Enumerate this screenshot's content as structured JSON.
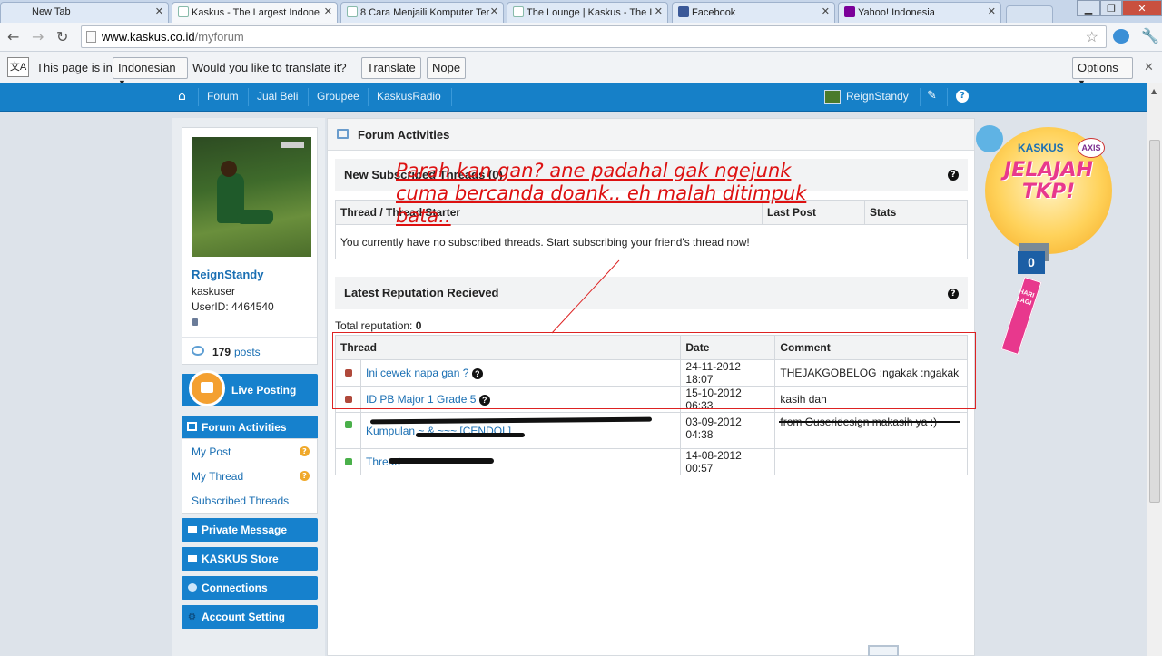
{
  "browser": {
    "tabs": [
      {
        "title": "New Tab",
        "active": false
      },
      {
        "title": "Kaskus - The Largest Indone",
        "active": true
      },
      {
        "title": "8 Cara Menjaili Komputer Ter",
        "active": false
      },
      {
        "title": "The Lounge | Kaskus - The L",
        "active": false
      },
      {
        "title": "Facebook",
        "active": false
      },
      {
        "title": "Yahoo! Indonesia",
        "active": false
      }
    ],
    "url_host": "www.kaskus.co.id",
    "url_path": "/myforum"
  },
  "translate_bar": {
    "prefix": "This page is in",
    "language": "Indonesian",
    "question": "Would you like to translate it?",
    "translate_label": "Translate",
    "nope_label": "Nope",
    "options_label": "Options"
  },
  "site_nav": {
    "items": [
      "Forum",
      "Jual Beli",
      "Groupee",
      "KaskusRadio"
    ],
    "username": "ReignStandy"
  },
  "profile": {
    "username": "ReignStandy",
    "rank": "kaskuser",
    "user_id": "UserID: 4464540",
    "post_count": "179",
    "posts_label": "posts"
  },
  "sidebar": {
    "live_posting": "Live Posting",
    "forum_activities": "Forum Activities",
    "sub_items": [
      "My Post",
      "My Thread",
      "Subscribed Threads"
    ],
    "private_message": "Private Message",
    "kaskus_store": "KASKUS Store",
    "connections": "Connections",
    "account_setting": "Account Setting"
  },
  "main": {
    "title": "Forum Activities",
    "subscribed": {
      "title": "New Subscribed Threads (0)",
      "columns": [
        "Thread / Thread Starter",
        "Last Post",
        "Stats"
      ],
      "empty_message": "You currently have no subscribed threads. Start subscribing your friend's thread now!"
    },
    "reputation": {
      "title": "Latest Reputation Recieved",
      "total_label": "Total reputation:",
      "total_value": "0",
      "columns": [
        "Thread",
        "Date",
        "Comment"
      ],
      "rows": [
        {
          "thread": "Ini cewek napa gan ?",
          "date": "24-11-2012 18:07",
          "comment": "THEJAKGOBELOG :ngakak :ngakak",
          "color": "#b0493b"
        },
        {
          "thread": "ID PB Major 1 Grade 5",
          "date": "15-10-2012 06:33",
          "comment": "kasih dah",
          "color": "#b0493b"
        },
        {
          "thread": "Kumpulan ~ & ~~~ [CENDOL]",
          "date": "03-09-2012 04:38",
          "comment": "from Ouseridesign makasih ya :)",
          "color": "#4ab04a"
        },
        {
          "thread": "Thread ~~~",
          "date": "14-08-2012 00:57",
          "comment": "",
          "color": "#4ab04a"
        }
      ]
    }
  },
  "banner": {
    "brand": "KASKUS",
    "partner": "AXIS",
    "headline": "JELAJAH TKP!",
    "counter": "0",
    "ribbon": "HARI LAGI"
  },
  "annotation": {
    "line1": "Parah kan gan? ane padahal gak ngejunk",
    "line2": "cuma bercanda doank.. eh malah ditimpuk",
    "line3": "bata.."
  },
  "colors": {
    "nav_blue": "#1680c8",
    "link_blue": "#1a6fb3",
    "annotation_red": "#d11111"
  }
}
